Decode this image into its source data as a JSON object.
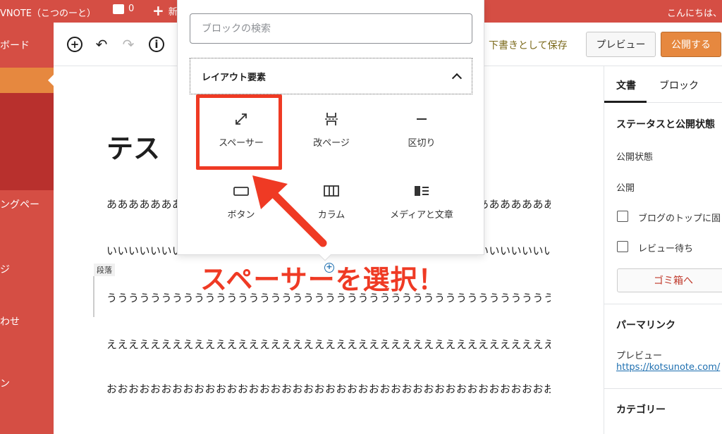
{
  "adminbar": {
    "site_name": "VNOTE（こつのーと）",
    "comment_count": "0",
    "new_label": "新",
    "howdy": "こんにちは、"
  },
  "admin_menu": {
    "items": [
      "ボード",
      "ングペー",
      "ジ",
      "わせ",
      "ン"
    ]
  },
  "toolbar": {
    "save_draft": "下書きとして保存",
    "preview": "プレビュー",
    "publish": "公開する"
  },
  "post": {
    "title": "テス",
    "paragraphs": [
      "あああああああああああああああああああああああああああああああああああああああああああ",
      "いいいいいいいいいいいいいいいいいいいいいいいいいいいいいいいいいいいいいいいいいいいい",
      "うううううううううううううううううううううううううううううううううううううううううううう",
      "えええええええええええええええええええええええええええええええええええええええええええ",
      "おおおおおおおおおおおおおおおおおおおおおおおおおおおおおおおおおおおおおおおおおおおお"
    ],
    "block_label": "段落"
  },
  "settings": {
    "tab_document": "文書",
    "tab_block": "ブロック",
    "status_heading": "ステータスと公開状態",
    "visibility_label": "公開状態",
    "publish_label": "公開",
    "sticky_label": "ブログのトップに固",
    "pending_label": "レビュー待ち",
    "trash_label": "ゴミ箱へ",
    "permalink_heading": "パーマリンク",
    "preview_label": "プレビュー",
    "permalink_url": "https://kotsunote.com/",
    "category_heading": "カテゴリー"
  },
  "inserter": {
    "search_placeholder": "ブロックの検索",
    "panel_title": "レイアウト要素",
    "blocks": [
      {
        "label": "スペーサー",
        "icon": "resize-arrow-icon"
      },
      {
        "label": "改ページ",
        "icon": "page-break-icon"
      },
      {
        "label": "区切り",
        "icon": "separator-icon"
      },
      {
        "label": "ボタン",
        "icon": "button-icon"
      },
      {
        "label": "カラム",
        "icon": "columns-icon"
      },
      {
        "label": "メディアと文章",
        "icon": "media-text-icon"
      }
    ]
  },
  "annotation": {
    "text": "スペーサーを選択！"
  },
  "colors": {
    "admin_red": "#d54e44",
    "accent_orange": "#e6883f",
    "highlight_red": "#ef3a24",
    "link_blue": "#1e6fb0"
  }
}
